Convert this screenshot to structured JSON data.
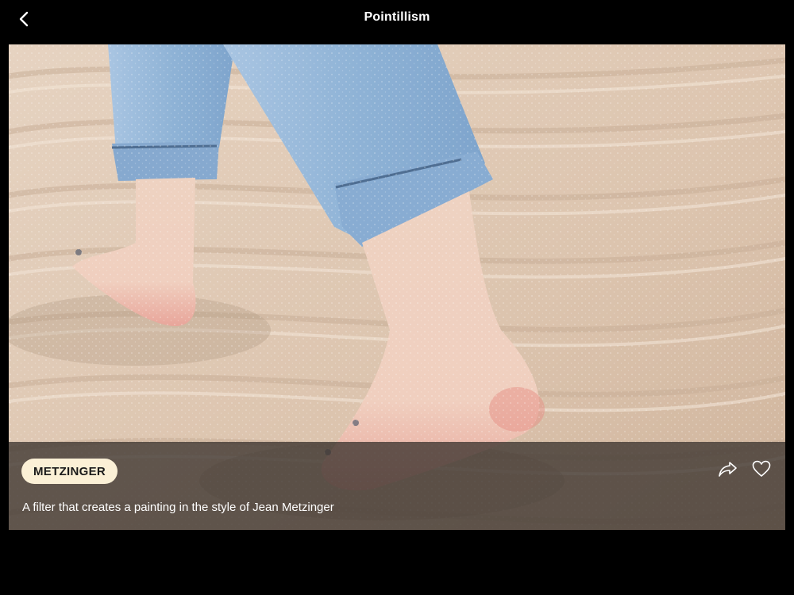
{
  "header": {
    "title": "Pointillism",
    "back_icon": "chevron-left-icon"
  },
  "filter_card": {
    "tag_label": "METZINGER",
    "description": "A filter that creates a painting in the style of Jean Metzinger",
    "share_icon": "share-arrow-icon",
    "favorite_icon": "heart-outline-icon",
    "photo_subject": "bare feet walking on rippled sand in rolled-up jeans"
  },
  "colors": {
    "background": "#000000",
    "tag_background": "#fbf0d6",
    "tag_text": "#1a1a1a",
    "info_bar_overlay": "#3c342f",
    "sand": "#e2cdb9",
    "denim": "#8fb3d6"
  }
}
